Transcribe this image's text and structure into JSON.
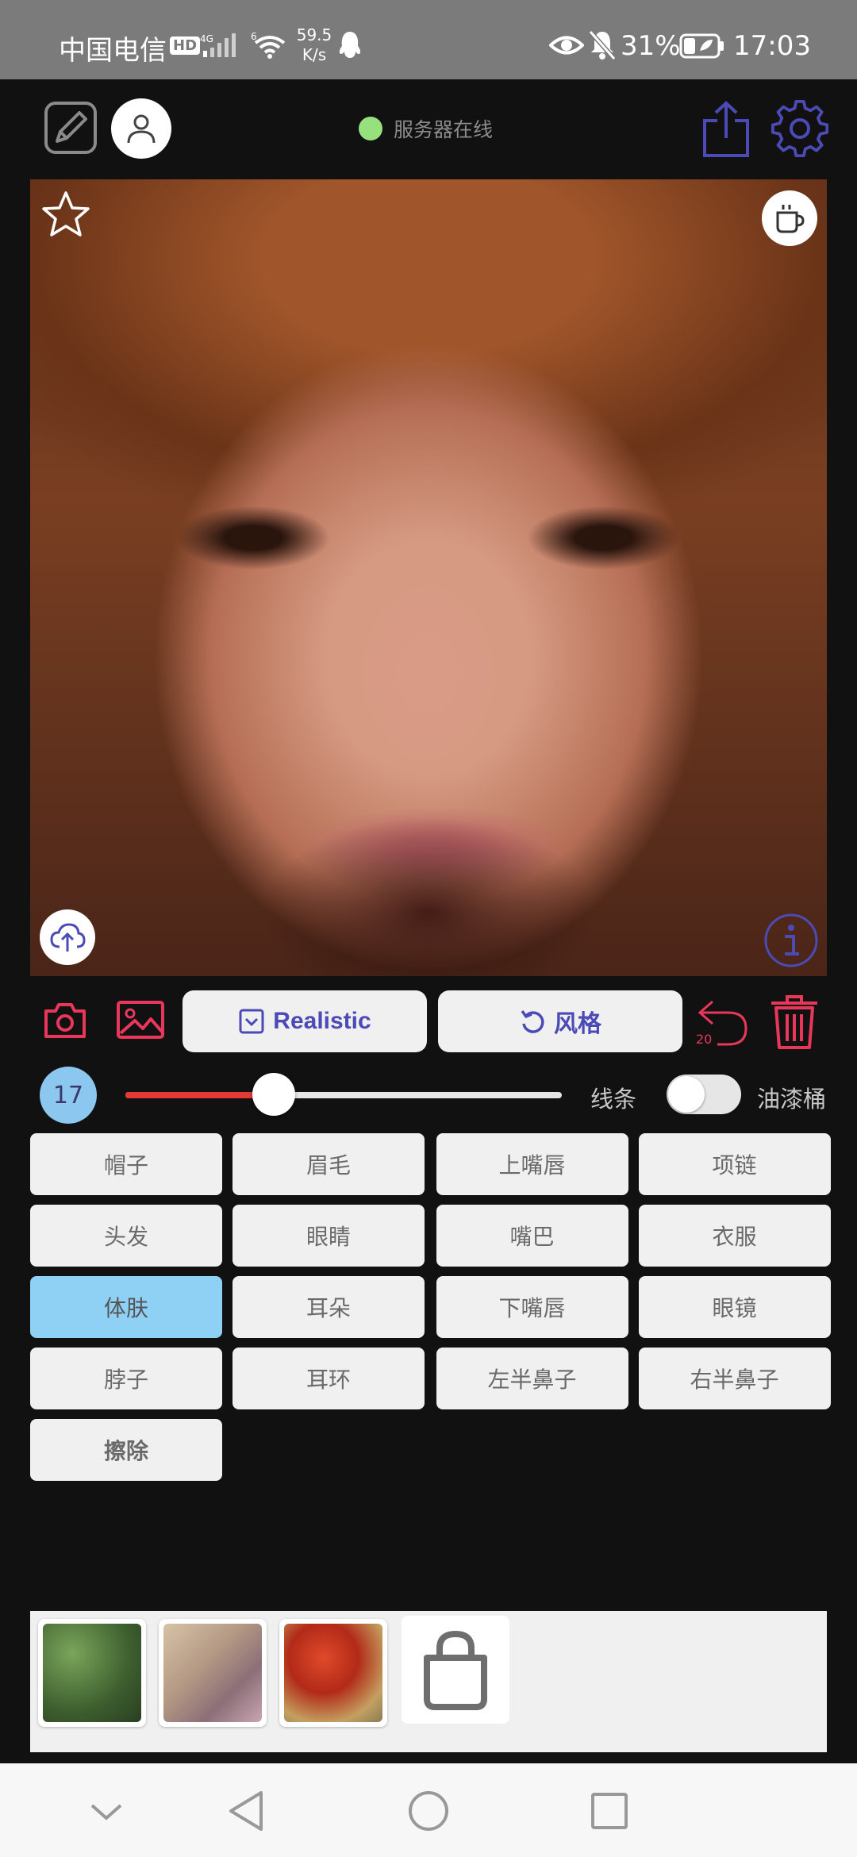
{
  "status_bar": {
    "carrier": "中国电信",
    "hd_badge": "HD",
    "network_type": "4G",
    "network_type_2": "6",
    "speed_value": "59.5",
    "speed_unit": "K/s",
    "battery_percent": "31%",
    "time": "17:03"
  },
  "header": {
    "server_status": "服务器在线",
    "server_status_color": "#96e07d"
  },
  "actions": {
    "realistic_label": "Realistic",
    "style_label": "风格",
    "undo_count": "20",
    "accent_color": "#e8375a",
    "primary_color": "#4c4ab6"
  },
  "brush": {
    "size": "17",
    "slider_fraction": 0.34,
    "mode_line": "线条",
    "mode_bucket": "油漆桶",
    "bucket_enabled": false
  },
  "parts": [
    {
      "label": "帽子",
      "selected": false
    },
    {
      "label": "眉毛",
      "selected": false
    },
    {
      "label": "上嘴唇",
      "selected": false
    },
    {
      "label": "项链",
      "selected": false
    },
    {
      "label": "头发",
      "selected": false
    },
    {
      "label": "眼睛",
      "selected": false
    },
    {
      "label": "嘴巴",
      "selected": false
    },
    {
      "label": "衣服",
      "selected": false
    },
    {
      "label": "体肤",
      "selected": true
    },
    {
      "label": "耳朵",
      "selected": false
    },
    {
      "label": "下嘴唇",
      "selected": false
    },
    {
      "label": "眼镜",
      "selected": false
    },
    {
      "label": "脖子",
      "selected": false
    },
    {
      "label": "耳环",
      "selected": false
    },
    {
      "label": "左半鼻子",
      "selected": false
    },
    {
      "label": "右半鼻子",
      "selected": false
    },
    {
      "label": "擦除",
      "selected": false
    }
  ],
  "textures": [
    "grass-texture",
    "pebble-texture",
    "red-leaves-texture"
  ],
  "icons": {
    "edit": "edit-icon",
    "avatar": "user-icon",
    "share": "share-icon",
    "settings": "gear-icon",
    "favorite": "star-icon",
    "coffee": "coffee-icon",
    "upload": "cloud-upload-icon",
    "info": "info-icon",
    "camera": "camera-icon",
    "gallery": "image-icon",
    "undo": "undo-icon",
    "delete": "trash-icon",
    "shop": "shopping-bag-icon"
  }
}
